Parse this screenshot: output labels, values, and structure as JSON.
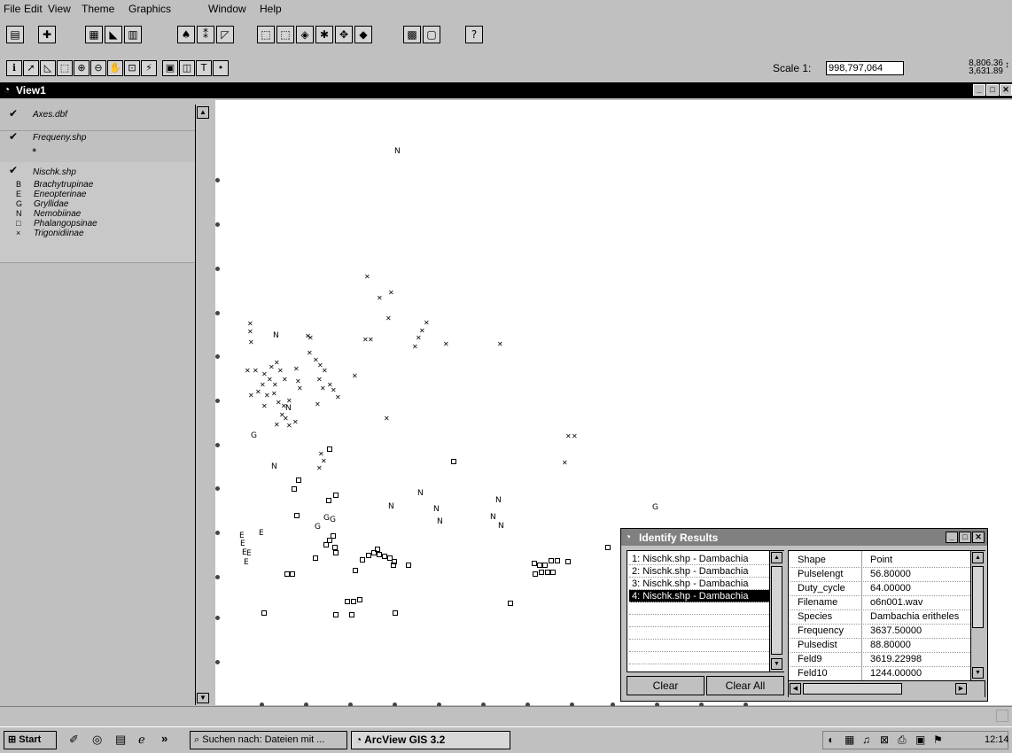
{
  "menu": [
    "File",
    "Edit",
    "View",
    "Theme",
    "Graphics",
    "Window",
    "Help"
  ],
  "toolbar": {
    "scale_label": "Scale 1:",
    "scale_value": "998,797,064",
    "coord_x": "8,806.36",
    "coord_y": "3,631.89"
  },
  "view": {
    "title": "View1"
  },
  "toc": {
    "themes": [
      {
        "name": "Axes.dbf"
      },
      {
        "name": "Frequeny.shp"
      },
      {
        "name": "Nischk.shp"
      }
    ],
    "legend": [
      {
        "symbol": "B",
        "label": "Brachytrupinae"
      },
      {
        "symbol": "E",
        "label": "Eneopterinae"
      },
      {
        "symbol": "G",
        "label": "Gryllidae"
      },
      {
        "symbol": "N",
        "label": "Nemobiinae"
      },
      {
        "symbol": "□",
        "label": "Phalangopsinae"
      },
      {
        "symbol": "×",
        "label": "Trigonidiinae"
      }
    ]
  },
  "identify": {
    "title": "Identify Results",
    "list": [
      "1: Nischk.shp - Dambachia",
      "2: Nischk.shp - Dambachia",
      "3: Nischk.shp - Dambachia",
      "4: Nischk.shp - Dambachia"
    ],
    "fields": [
      {
        "k": "Shape",
        "v": "Point"
      },
      {
        "k": "Pulselengt",
        "v": "56.80000"
      },
      {
        "k": "Duty_cycle",
        "v": "64.00000"
      },
      {
        "k": "Filename",
        "v": "o6n001.wav"
      },
      {
        "k": "Species",
        "v": "Dambachia eritheles"
      },
      {
        "k": "Frequency",
        "v": "3637.50000"
      },
      {
        "k": "Pulsedist",
        "v": "88.80000"
      },
      {
        "k": "Feld9",
        "v": "3619.22998"
      },
      {
        "k": "Feld10",
        "v": "1244.00000"
      }
    ],
    "clear": "Clear",
    "clear_all": "Clear All"
  },
  "taskbar": {
    "start": "Start",
    "chevron": "»",
    "task1": "Suchen nach: Dateien mit ...",
    "task2": "ArcView GIS 3.2",
    "clock": "12:14"
  },
  "map_labels": {
    "N": "N",
    "G": "G",
    "E": "E"
  }
}
